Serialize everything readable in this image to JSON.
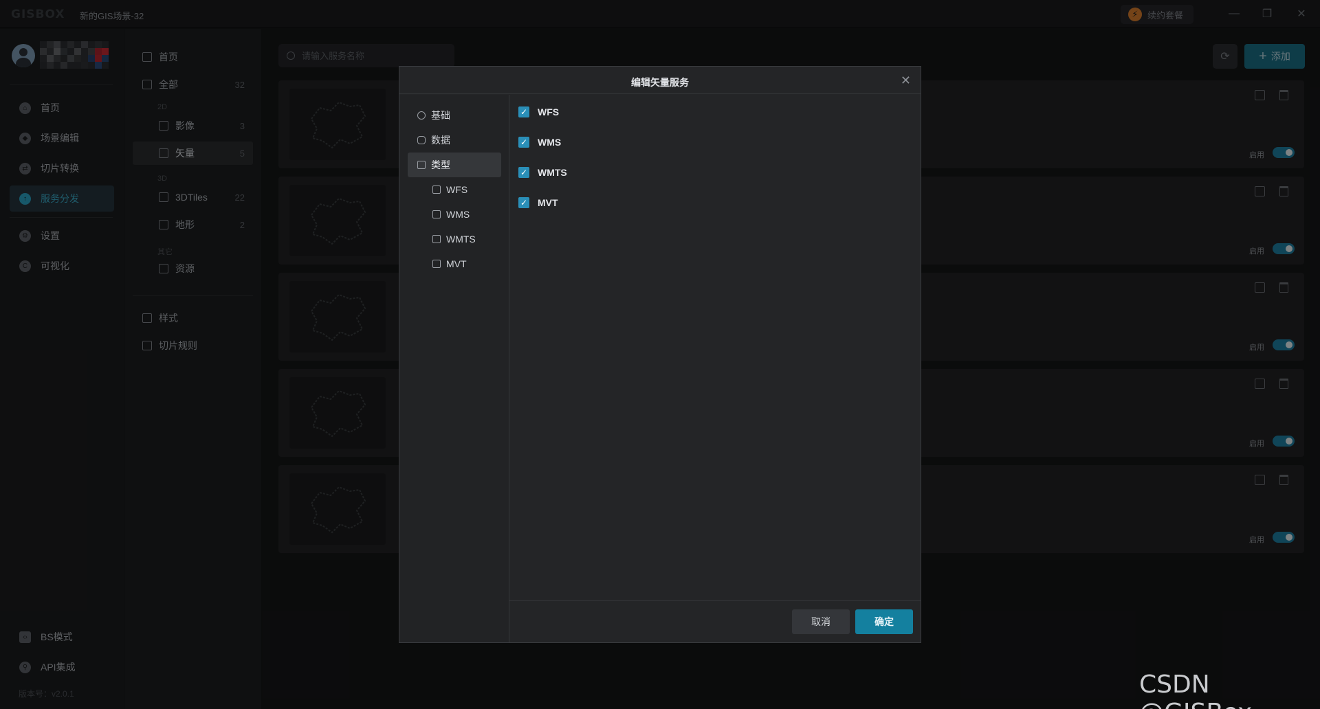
{
  "app": {
    "logo": "GISBOX",
    "title": "新的GIS场景-32",
    "renew_label": "续约套餐"
  },
  "leftnav": {
    "items": [
      {
        "label": "首页",
        "icon": "home-icon"
      },
      {
        "label": "场景编辑",
        "icon": "cube-icon"
      },
      {
        "label": "切片转换",
        "icon": "convert-icon"
      },
      {
        "label": "服务分发",
        "icon": "upload-icon"
      },
      {
        "label": "设置",
        "icon": "gear-icon"
      },
      {
        "label": "可视化",
        "icon": "chart-icon"
      }
    ],
    "bottom": [
      {
        "label": "BS模式",
        "icon": "code-icon"
      },
      {
        "label": "API集成",
        "icon": "api-icon"
      }
    ],
    "version": "版本号：v2.0.1",
    "active_index": 3
  },
  "subnav": {
    "home": "首页",
    "all": {
      "label": "全部",
      "count": "32"
    },
    "group_2d": "2D",
    "image": {
      "label": "影像",
      "count": "3"
    },
    "vector": {
      "label": "矢量",
      "count": "5"
    },
    "group_3d": "3D",
    "tiles3d": {
      "label": "3DTiles",
      "count": "22"
    },
    "terrain": {
      "label": "地形",
      "count": "2"
    },
    "group_other": "其它",
    "resource": "资源",
    "style": "样式",
    "tile_rules": "切片规则"
  },
  "main": {
    "search_placeholder": "请输入服务名称",
    "add_label": "添加",
    "enable_label": "启用",
    "card_count": 5
  },
  "dialog": {
    "title": "编辑矢量服务",
    "side": [
      {
        "label": "基础",
        "icon": "basic-icon"
      },
      {
        "label": "数据",
        "icon": "database-icon"
      },
      {
        "label": "类型",
        "icon": "type-icon"
      },
      {
        "label": "WFS",
        "icon": "type-icon"
      },
      {
        "label": "WMS",
        "icon": "type-icon"
      },
      {
        "label": "WMTS",
        "icon": "type-icon"
      },
      {
        "label": "MVT",
        "icon": "type-icon"
      }
    ],
    "options": [
      {
        "label": "WFS",
        "checked": true
      },
      {
        "label": "WMS",
        "checked": true
      },
      {
        "label": "WMTS",
        "checked": true
      },
      {
        "label": "MVT",
        "checked": true
      }
    ],
    "cancel_label": "取消",
    "ok_label": "确定"
  },
  "watermark": "CSDN @GISBox",
  "colors": {
    "accent": "#14809f",
    "checkbox": "#2a8fb8",
    "active_nav": "#39a9c7"
  }
}
